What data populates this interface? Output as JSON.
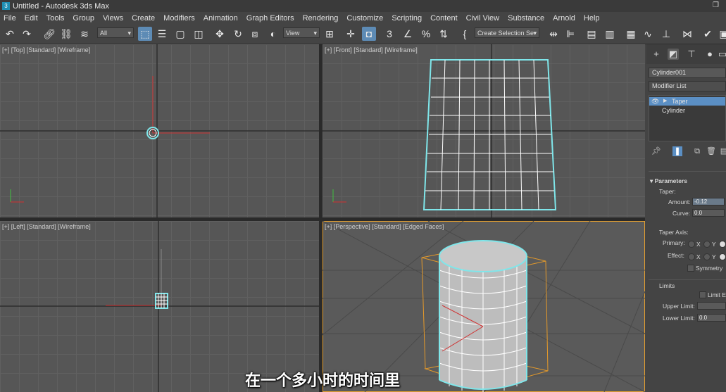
{
  "window": {
    "title": "Untitled - Autodesk 3ds Max"
  },
  "menu": [
    "File",
    "Edit",
    "Tools",
    "Group",
    "Views",
    "Create",
    "Modifiers",
    "Animation",
    "Graph Editors",
    "Rendering",
    "Customize",
    "Scripting",
    "Content",
    "Civil View",
    "Substance",
    "Arnold",
    "Help"
  ],
  "toolbar": {
    "filter_value": "All",
    "refcoord_value": "View",
    "selection_set_value": "Create Selection Se"
  },
  "viewports": {
    "top": "[+] [Top] [Standard] [Wireframe]",
    "front": "[+] [Front] [Standard] [Wireframe]",
    "left": "[+] [Left] [Standard] [Wireframe]",
    "perspective": "[+] [Perspective] [Standard] [Edged Faces]"
  },
  "command_panel": {
    "object_name": "Cylinder001",
    "modifier_list": "Modifier List",
    "stack": [
      "Taper",
      "Cylinder"
    ],
    "parameters_title": "Parameters",
    "taper_label": "Taper:",
    "amount_label": "Amount:",
    "amount_value": "-0.12",
    "curve_label": "Curve:",
    "curve_value": "0.0",
    "taper_axis_label": "Taper Axis:",
    "primary_label": "Primary:",
    "effect_label": "Effect:",
    "x": "X",
    "y": "Y",
    "symmetry_label": "Symmetry",
    "limits_label": "Limits",
    "limit_effect_label": "Limit Ef",
    "upper_limit_label": "Upper Limit:",
    "lower_limit_label": "Lower Limit:",
    "lower_limit_value": "0.0"
  },
  "subtitle": "在一个多小时的时间里",
  "colors": {
    "selection_cyan": "#7fe6ea",
    "bbox_orange": "#e59a2a",
    "accent_blue": "#5b8fc4"
  }
}
